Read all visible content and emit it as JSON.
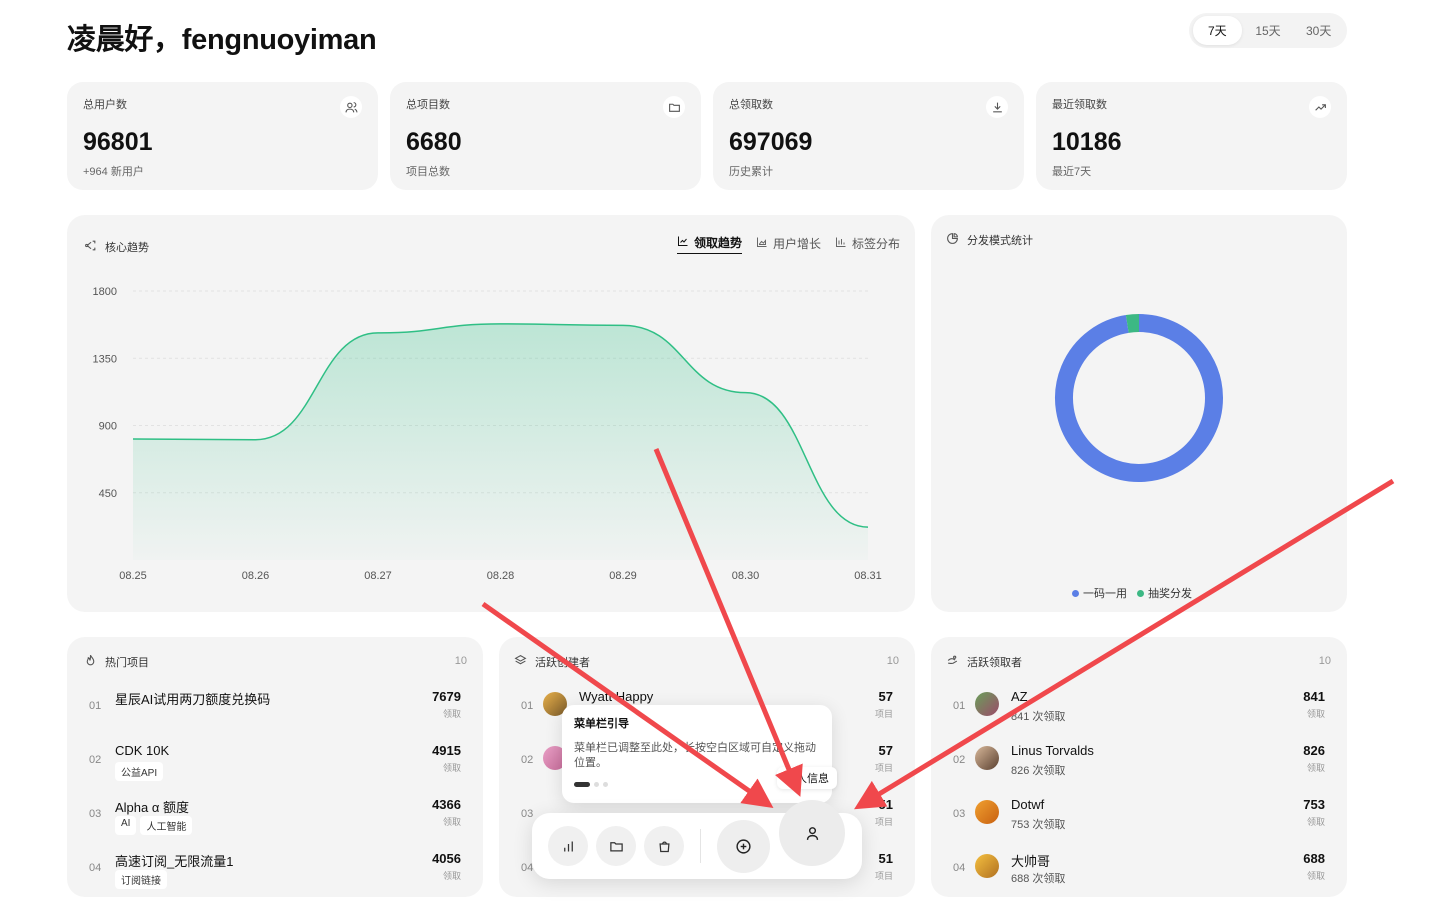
{
  "header": {
    "greeting": "凌晨好，fengnuoyiman",
    "ranges": [
      "7天",
      "15天",
      "30天"
    ],
    "active_range": "7天"
  },
  "stats": [
    {
      "label": "总用户数",
      "value": "96801",
      "sub": "+964 新用户",
      "icon": "users-icon"
    },
    {
      "label": "总项目数",
      "value": "6680",
      "sub": "项目总数",
      "icon": "folder-icon"
    },
    {
      "label": "总领取数",
      "value": "697069",
      "sub": "历史累计",
      "icon": "download-icon"
    },
    {
      "label": "最近领取数",
      "value": "10186",
      "sub": "最近7天",
      "icon": "trending-up-icon"
    }
  ],
  "trend": {
    "title": "核心趋势",
    "tabs": [
      "领取趋势",
      "用户增长",
      "标签分布"
    ],
    "active_tab": "领取趋势",
    "y_ticks": [
      "1800",
      "1350",
      "900",
      "450"
    ],
    "color": "#2fbf85"
  },
  "distribution": {
    "title": "分发模式统计",
    "legend": [
      "一码一用",
      "抽奖分发"
    ],
    "colors": [
      "#5b7fe6",
      "#3cb884"
    ]
  },
  "chart_data": [
    {
      "type": "area",
      "title": "",
      "x": [
        "08.25",
        "08.26",
        "08.27",
        "08.28",
        "08.29",
        "08.30",
        "08.31"
      ],
      "values": [
        810,
        805,
        1520,
        1580,
        1570,
        1120,
        220
      ],
      "ylim": [
        0,
        1800
      ],
      "yticks": [
        450,
        900,
        1350,
        1800
      ],
      "grid": true
    },
    {
      "type": "pie",
      "donut": true,
      "categories": [
        "一码一用",
        "抽奖分发"
      ],
      "values": [
        97.5,
        2.5
      ],
      "legend": "bottom"
    }
  ],
  "hot_projects": {
    "title": "热门项目",
    "count": "10",
    "items": [
      {
        "rank": "01",
        "name": "星辰AI试用两刀额度兑换码",
        "tags": [],
        "value": "7679",
        "unit": "领取"
      },
      {
        "rank": "02",
        "name": "CDK 10K",
        "tags": [
          "公益API"
        ],
        "value": "4915",
        "unit": "领取"
      },
      {
        "rank": "03",
        "name": "Alpha α 额度",
        "tags": [
          "AI",
          "人工智能"
        ],
        "value": "4366",
        "unit": "领取"
      },
      {
        "rank": "04",
        "name": "高速订阅_无限流量1",
        "tags": [
          "订阅链接"
        ],
        "value": "4056",
        "unit": "领取"
      }
    ]
  },
  "active_creators": {
    "title": "活跃创建者",
    "count": "10",
    "items": [
      {
        "rank": "01",
        "name": "Wyatt Happy",
        "value": "57",
        "unit": "项目"
      },
      {
        "rank": "02",
        "name": "",
        "value": "57",
        "unit": "项目"
      },
      {
        "rank": "03",
        "name": "",
        "value": "51",
        "unit": "项目"
      },
      {
        "rank": "04",
        "name": "",
        "value": "51",
        "unit": "项目"
      }
    ]
  },
  "active_receivers": {
    "title": "活跃领取者",
    "count": "10",
    "items": [
      {
        "rank": "01",
        "name": "AZ",
        "sub": "841 次领取",
        "value": "841",
        "unit": "领取"
      },
      {
        "rank": "02",
        "name": "Linus Torvalds",
        "sub": "826 次领取",
        "value": "826",
        "unit": "领取"
      },
      {
        "rank": "03",
        "name": "Dotwf",
        "sub": "753 次领取",
        "value": "753",
        "unit": "领取"
      },
      {
        "rank": "04",
        "name": "大帅哥",
        "sub": "688 次领取",
        "value": "688",
        "unit": "领取"
      }
    ]
  },
  "guide": {
    "title": "菜单栏引导",
    "body": "菜单栏已调整至此处，长按空白区域可自定义拖动位置。",
    "tooltip": "个人信息"
  },
  "dock": {
    "buttons": [
      "bar-chart-icon",
      "folder-icon",
      "shopping-bag-icon",
      "plus-circle-icon",
      "user-icon"
    ]
  },
  "annotation_color": "#f0484c"
}
